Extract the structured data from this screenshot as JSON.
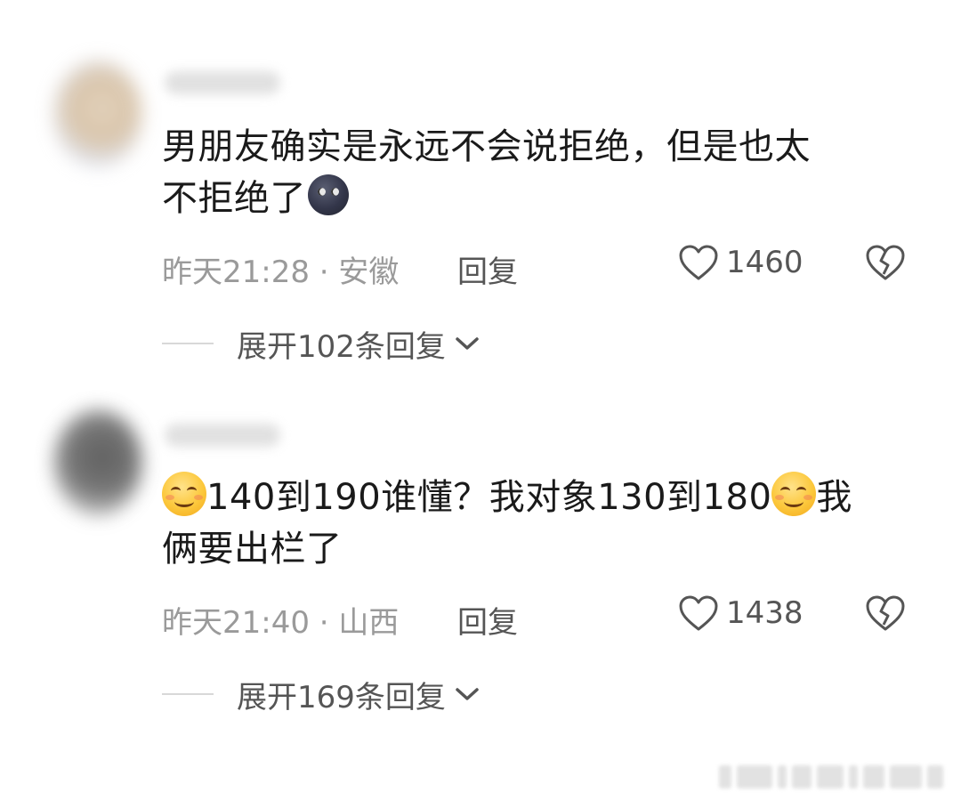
{
  "comments": [
    {
      "text_line1": "男朋友确实是永远不会说拒绝，但是也太",
      "text_line2": "不拒绝了",
      "emoji": "new-moon-face",
      "time_location": "昨天21:28 · 安徽",
      "reply_label": "回复",
      "like_count": "1460",
      "expand_label": "展开102条回复"
    },
    {
      "text_line1_a": "140到190谁懂？我对象130到180",
      "text_line1_b": "我",
      "text_line2": "俩要出栏了",
      "emoji": "smiling-face",
      "time_location": "昨天21:40 · 山西",
      "reply_label": "回复",
      "like_count": "1438",
      "expand_label": "展开169条回复"
    }
  ],
  "icons": {
    "like": "heart-outline-icon",
    "dislike": "broken-heart-icon",
    "expand": "chevron-down-icon"
  },
  "colors": {
    "text": "#1a1a1a",
    "meta": "#9a9a9a",
    "action": "#555555"
  }
}
